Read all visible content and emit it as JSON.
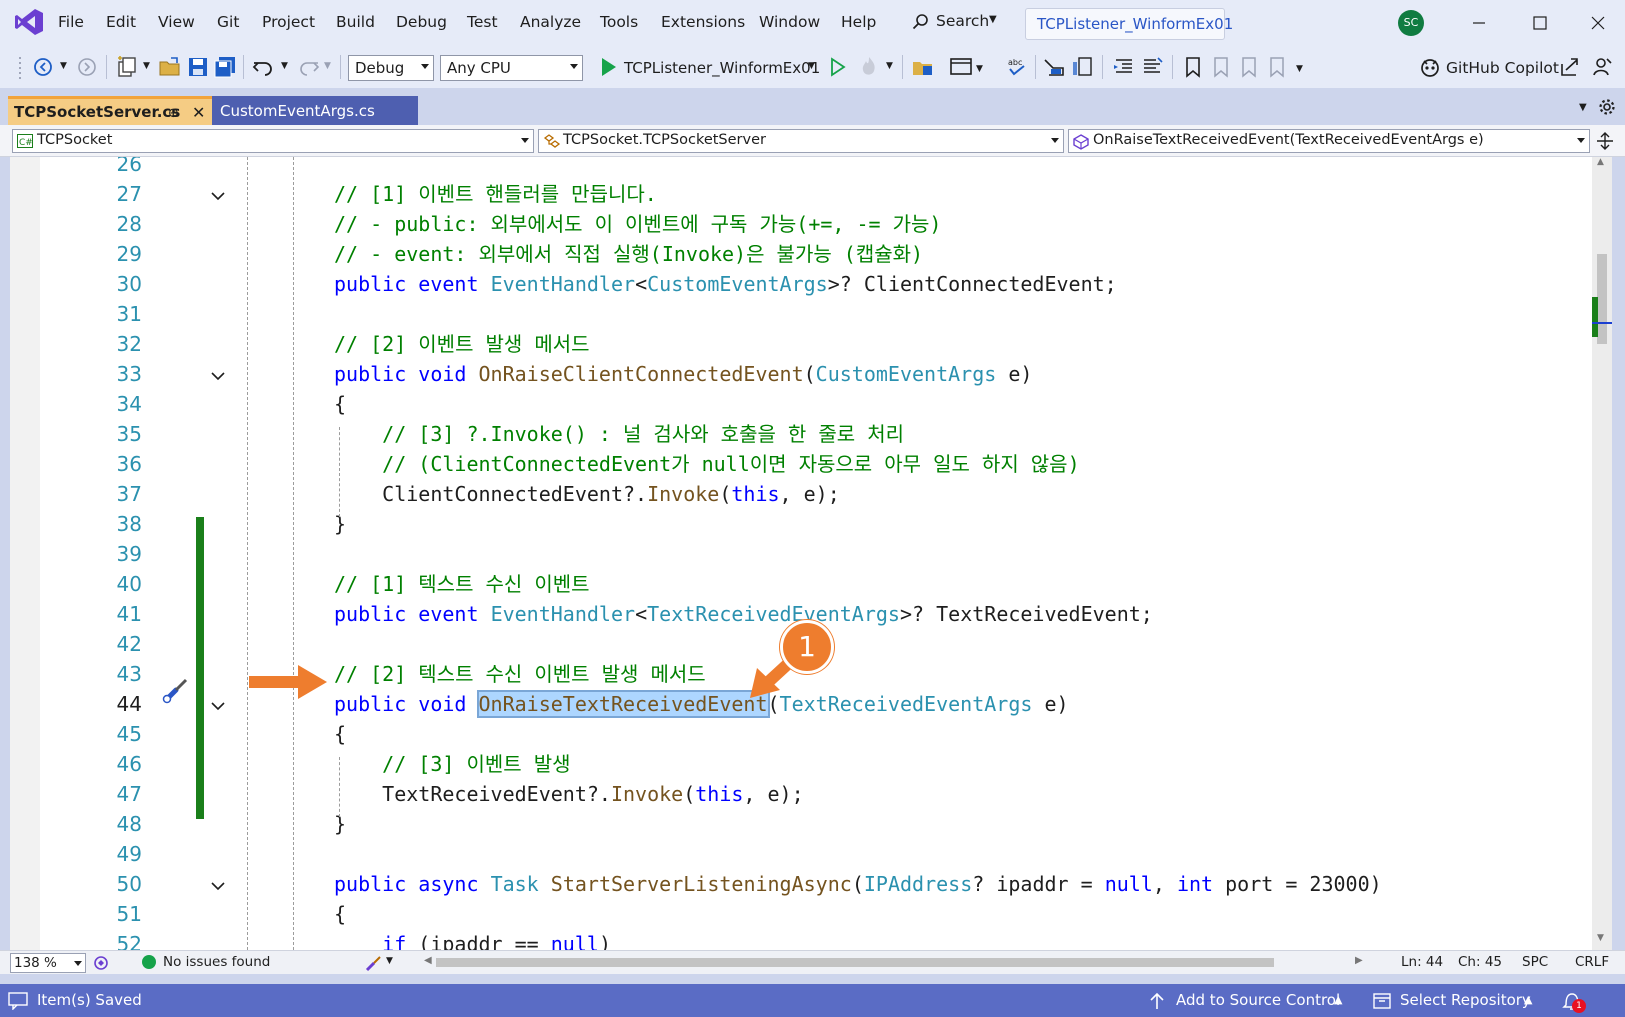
{
  "menu": [
    "File",
    "Edit",
    "View",
    "Git",
    "Project",
    "Build",
    "Debug",
    "Test",
    "Analyze",
    "Tools",
    "Extensions",
    "Window",
    "Help"
  ],
  "search_label": "Search",
  "solution_title": "TCPListener_WinformEx01",
  "user_initials": "SC",
  "toolbar": {
    "config": "Debug",
    "platform": "Any CPU",
    "start_target": "TCPListener_WinformEx01",
    "copilot_label": "GitHub Copilot"
  },
  "tabs": [
    {
      "label": "TCPSocketServer.cs",
      "pin": "⊕",
      "close": "✕"
    },
    {
      "label": "CustomEventArgs.cs"
    }
  ],
  "navbar": {
    "project": "TCPSocket",
    "type": "TCPSocket.TCPSocketServer",
    "member": "OnRaiseTextReceivedEvent(TextReceivedEventArgs e)"
  },
  "editor": {
    "current_line": 44,
    "lines": [
      {
        "n": "26",
        "html": ""
      },
      {
        "n": "27",
        "html": "<span class='cm'>// [1] 이벤트 핸들러를 만듭니다.</span>"
      },
      {
        "n": "28",
        "html": "<span class='cm'>// - public: 외부에서도 이 이벤트에 구독 가능(+=, -= 가능)</span>"
      },
      {
        "n": "29",
        "html": "<span class='cm'>// - event: 외부에서 직접 실행(Invoke)은 불가능 (캡슐화)</span>"
      },
      {
        "n": "30",
        "html": "<span class='kw'>public</span> <span class='kw'>event</span> <span class='ty'>EventHandler</span>&lt;<span class='ty'>CustomEventArgs</span>&gt;? ClientConnectedEvent;"
      },
      {
        "n": "31",
        "html": ""
      },
      {
        "n": "32",
        "html": "<span class='cm'>// [2] 이벤트 발생 메서드</span>"
      },
      {
        "n": "33",
        "html": "<span class='kw'>public</span> <span class='kw'>void</span> <span class='mt'>OnRaiseClientConnectedEvent</span>(<span class='ty'>CustomEventArgs</span> e)"
      },
      {
        "n": "34",
        "html": "{"
      },
      {
        "n": "35",
        "html": "    <span class='cm'>// [3] ?.Invoke() : 널 검사와 호출을 한 줄로 처리</span>"
      },
      {
        "n": "36",
        "html": "    <span class='cm'>// (ClientConnectedEvent가 null이면 자동으로 아무 일도 하지 않음)</span>"
      },
      {
        "n": "37",
        "html": "    ClientConnectedEvent?.<span class='mt'>Invoke</span>(<span class='kw'>this</span>, e);"
      },
      {
        "n": "38",
        "html": "}"
      },
      {
        "n": "39",
        "html": ""
      },
      {
        "n": "40",
        "html": "<span class='cm'>// [1] 텍스트 수신 이벤트</span>"
      },
      {
        "n": "41",
        "html": "<span class='kw'>public</span> <span class='kw'>event</span> <span class='ty'>EventHandler</span>&lt;<span class='ty'>TextReceivedEventArgs</span>&gt;? TextReceivedEvent;"
      },
      {
        "n": "42",
        "html": ""
      },
      {
        "n": "43",
        "html": "<span class='cm'>// [2] 텍스트 수신 이벤트 발생 메서드</span>"
      },
      {
        "n": "44",
        "html": "<span class='kw'>public</span> <span class='kw'>void</span> <span class='mt sel'>OnRaiseTextReceivedEvent</span>(<span class='ty'>TextReceivedEventArgs</span> e)"
      },
      {
        "n": "45",
        "html": "{"
      },
      {
        "n": "46",
        "html": "    <span class='cm'>// [3] 이벤트 발생</span>"
      },
      {
        "n": "47",
        "html": "    TextReceivedEvent?.<span class='mt'>Invoke</span>(<span class='kw'>this</span>, e);"
      },
      {
        "n": "48",
        "html": "}"
      },
      {
        "n": "49",
        "html": ""
      },
      {
        "n": "50",
        "html": "<span class='kw'>public</span> <span class='kw'>async</span> <span class='ty'>Task</span> <span class='mt'>StartServerListeningAsync</span>(<span class='ty'>IPAddress</span>? ipaddr = <span class='kw'>null</span>, <span class='kw'>int</span> port = 23000)"
      },
      {
        "n": "51",
        "html": "{"
      },
      {
        "n": "52",
        "html": "    <span class='kw'>if</span> (ipaddr == <span class='kw'>null</span>)"
      }
    ]
  },
  "editor_status": {
    "zoom": "138 %",
    "issues": "No issues found",
    "line": "Ln: 44",
    "col": "Ch: 45",
    "whitespace": "SPC",
    "line_ending": "CRLF"
  },
  "statusbar": {
    "message": "Item(s) Saved",
    "source_control": "Add to Source Control",
    "repository": "Select Repository",
    "notification_count": "1"
  },
  "annotation": {
    "badge": "1"
  },
  "colors": {
    "accent": "#5a6cc5",
    "annotation": "#ee7d2e",
    "change_bar": "#1a7f1a"
  }
}
